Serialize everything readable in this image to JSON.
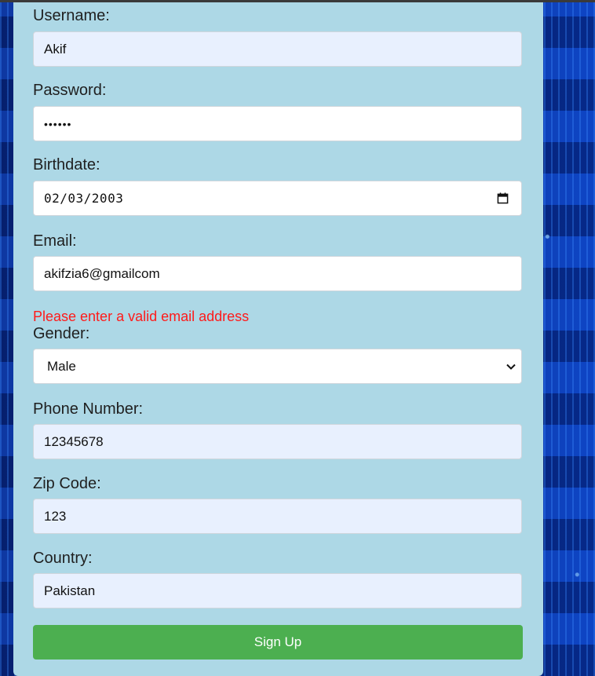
{
  "form": {
    "username": {
      "label": "Username:",
      "value": "Akif"
    },
    "password": {
      "label": "Password:",
      "value": "••••••"
    },
    "birthdate": {
      "label": "Birthdate:",
      "value": "02/03/2003"
    },
    "email": {
      "label": "Email:",
      "value": "akifzia6@gmailcom",
      "error": "Please enter a valid email address"
    },
    "gender": {
      "label": "Gender:",
      "value": "Male"
    },
    "phone": {
      "label": "Phone Number:",
      "value": "12345678"
    },
    "zip": {
      "label": "Zip Code:",
      "value": "123"
    },
    "country": {
      "label": "Country:",
      "value": "Pakistan"
    },
    "submit_label": "Sign Up"
  },
  "colors": {
    "panel": "#add8e6",
    "error": "#ff1a1a",
    "button": "#4caf50",
    "autofill": "#e8f0fe"
  },
  "icons": {
    "birthdate": "calendar-icon",
    "gender": "chevron-down-icon"
  }
}
